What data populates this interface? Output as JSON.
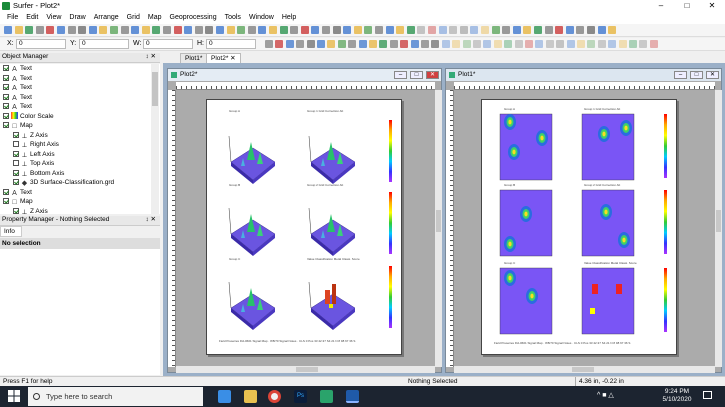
{
  "title": "Surfer - Plot2*",
  "window_controls": {
    "minimize": "–",
    "maximize": "□",
    "close": "✕"
  },
  "menu": [
    "File",
    "Edit",
    "View",
    "Draw",
    "Arrange",
    "Grid",
    "Map",
    "Geoprocessing",
    "Tools",
    "Window",
    "Help"
  ],
  "position_bar": {
    "x_label": "X:",
    "x_value": "0",
    "y_label": "Y:",
    "y_value": "0",
    "w_label": "W:",
    "w_value": "0",
    "h_label": "H:",
    "h_value": "0"
  },
  "object_manager": {
    "title": "Object Manager",
    "pin": "↕ ✕",
    "items": [
      {
        "label": "Text",
        "icon": "text-icon",
        "checked": true,
        "indent": 0
      },
      {
        "label": "Text",
        "icon": "text-icon",
        "checked": true,
        "indent": 0
      },
      {
        "label": "Text",
        "icon": "text-icon",
        "checked": true,
        "indent": 0
      },
      {
        "label": "Text",
        "icon": "text-icon",
        "checked": true,
        "indent": 0
      },
      {
        "label": "Text",
        "icon": "text-icon",
        "checked": true,
        "indent": 0
      },
      {
        "label": "Color Scale",
        "icon": "color-scale-icon",
        "checked": true,
        "indent": 0
      },
      {
        "label": "Map",
        "icon": "map-icon",
        "checked": true,
        "indent": 0
      },
      {
        "label": "Z Axis",
        "icon": "axis-icon",
        "checked": true,
        "indent": 1
      },
      {
        "label": "Right Axis",
        "icon": "axis-icon",
        "checked": false,
        "indent": 1
      },
      {
        "label": "Left Axis",
        "icon": "axis-icon",
        "checked": true,
        "indent": 1
      },
      {
        "label": "Top Axis",
        "icon": "axis-icon",
        "checked": false,
        "indent": 1
      },
      {
        "label": "Bottom Axis",
        "icon": "axis-icon",
        "checked": true,
        "indent": 1
      },
      {
        "label": "3D Surface-Classification.grd",
        "icon": "surface-icon",
        "checked": true,
        "indent": 1
      },
      {
        "label": "Text",
        "icon": "text-icon",
        "checked": true,
        "indent": 0
      },
      {
        "label": "Map",
        "icon": "map-icon",
        "checked": true,
        "indent": 0
      },
      {
        "label": "Z Axis",
        "icon": "axis-icon",
        "checked": true,
        "indent": 1
      }
    ]
  },
  "property_manager": {
    "title": "Property Manager - Nothing Selected",
    "tab": "Info",
    "selection": "No selection"
  },
  "doc_tabs": [
    {
      "label": "Plot1*"
    },
    {
      "label": "Plot2*",
      "active": true
    }
  ],
  "doc_tab_close": "✕",
  "windows": [
    {
      "title": "Plot2*"
    },
    {
      "title": "Plot1*"
    }
  ],
  "plot2_labels": {
    "row1": [
      "Group A",
      "Group 1  Grid Correction  Alt"
    ],
    "row2": [
      "Group B",
      "Group 2  Grid Correction  Alt"
    ],
    "row3": [
      "Group C",
      "Value Classification  Metal Classi. Score"
    ],
    "footer": "Field Preseries Fld-0601  Signal Map · 8/8/70  Signal Notes · CLS 0  Pos 33  42.37 S4 21 N  8 98 67 36 S"
  },
  "status": {
    "help": "Press F1 for help",
    "selection": "Nothing Selected",
    "coords": "4.36 in, -0.22 in"
  },
  "taskbar": {
    "search": "Type here to search",
    "time": "9:24 PM",
    "date": "5/10/2020"
  },
  "colors": {
    "accent": "#3c78d8",
    "surface": "#7a5cff",
    "heat_high": "#ff2a00"
  }
}
